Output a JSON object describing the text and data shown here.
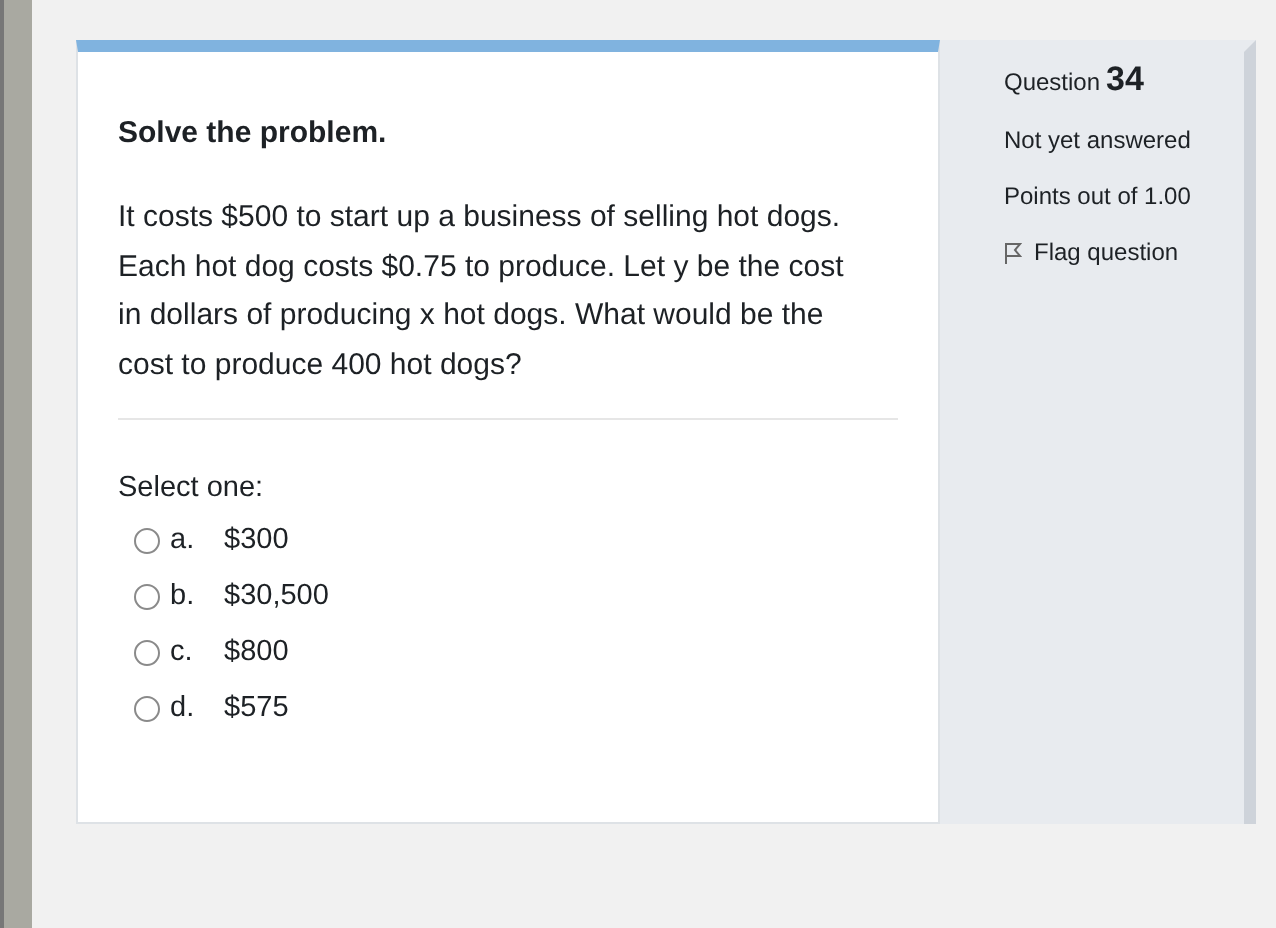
{
  "question": {
    "heading": "Solve the problem.",
    "text": "It costs $500 to start up a business of selling hot dogs. Each hot dog costs $0.75 to produce. Let y be the cost in dollars of producing x hot dogs. What would be the cost to produce 400 hot dogs?",
    "prompt": "Select one:",
    "options": [
      {
        "letter": "a.",
        "value": "$300",
        "selected": false
      },
      {
        "letter": "b.",
        "value": "$30,500",
        "selected": false
      },
      {
        "letter": "c.",
        "value": "$800",
        "selected": false
      },
      {
        "letter": "d.",
        "value": "$575",
        "selected": false
      }
    ]
  },
  "info": {
    "label": "Question",
    "number": "34",
    "status": "Not yet answered",
    "points": "Points out of 1.00",
    "flag": "Flag question"
  }
}
